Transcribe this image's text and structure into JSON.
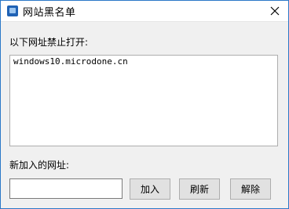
{
  "window": {
    "title": "网站黑名单",
    "icon": "app-window-icon",
    "close_icon": "close-icon"
  },
  "blocked": {
    "label": "以下网址禁止打开:",
    "items": [
      "windows10.microdone.cn"
    ]
  },
  "new_url": {
    "label": "新加入的网址:",
    "value": "",
    "placeholder": ""
  },
  "buttons": {
    "add": "加入",
    "refresh": "刷新",
    "remove": "解除"
  },
  "colors": {
    "window_border": "#2b78c8",
    "icon_blue": "#1f62b5",
    "button_face": "#e1e1e1"
  }
}
